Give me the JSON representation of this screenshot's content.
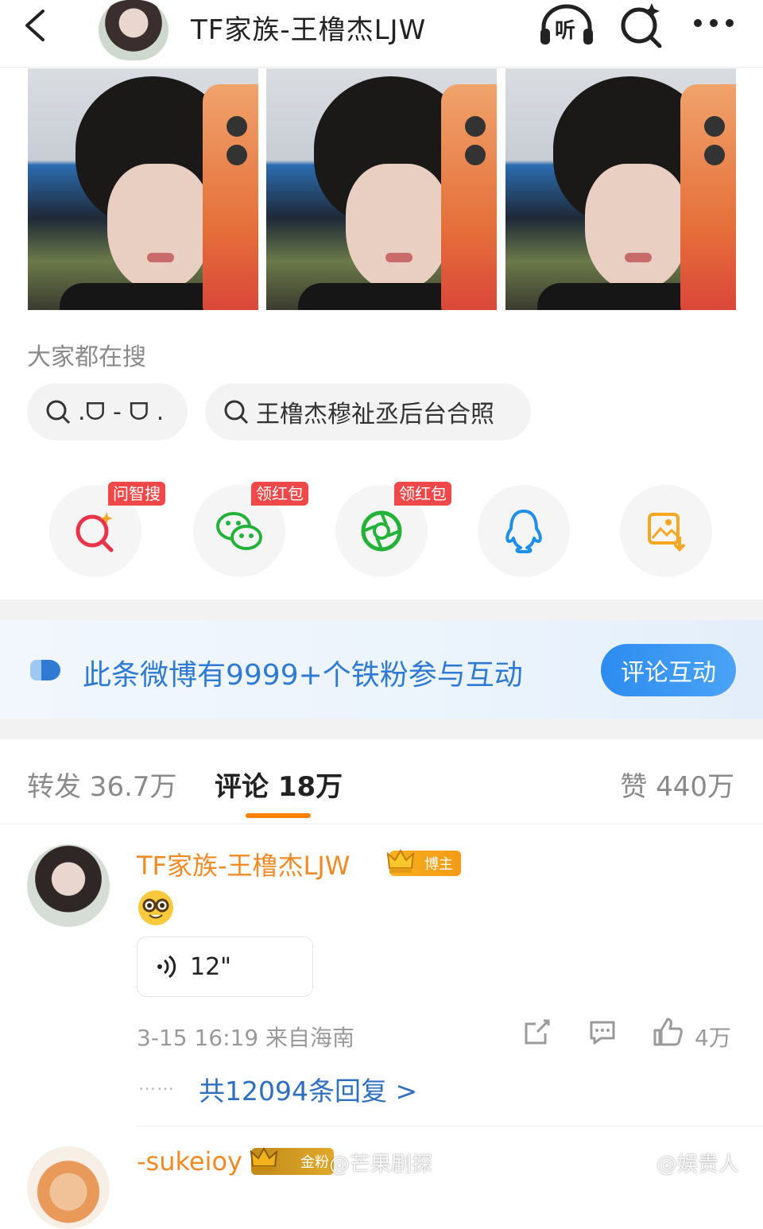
{
  "header": {
    "title": "TF家族-王橹杰LJW",
    "listen_label": "听"
  },
  "search": {
    "heading": "大家都在搜",
    "chips": [
      {
        "label": ".ᗜ - ᗜ ."
      },
      {
        "label": "王橹杰穆祉丞后台合照"
      }
    ]
  },
  "share": {
    "items": [
      {
        "icon": "ai-search-icon",
        "badge": "问智搜"
      },
      {
        "icon": "wechat-icon",
        "badge": "领红包"
      },
      {
        "icon": "moments-icon",
        "badge": "领红包"
      },
      {
        "icon": "qq-icon",
        "badge": ""
      },
      {
        "icon": "save-image-icon",
        "badge": ""
      }
    ]
  },
  "banner": {
    "text": "此条微博有9999+个铁粉参与互动",
    "button": "评论互动"
  },
  "tabs": {
    "repost": "转发 36.7万",
    "comments": "评论 18万",
    "likes": "赞 440万"
  },
  "comment": {
    "author": "TF家族-王橹杰LJW",
    "badge": "博主",
    "voice_length": "12\"",
    "meta": "3-15 16:19  来自海南",
    "likes": "4万",
    "replies_dots": "……",
    "replies": "共12094条回复 >"
  },
  "next_comment": {
    "author": "-sukeioy",
    "badge": "金粉"
  },
  "watermarks": {
    "left": "@芒果剧探",
    "right": "@娱贵人"
  },
  "colors": {
    "accent_orange": "#ff8200",
    "link_blue": "#2f6fbf",
    "badge_red": "#f04848",
    "name_orange": "#f08a24"
  }
}
